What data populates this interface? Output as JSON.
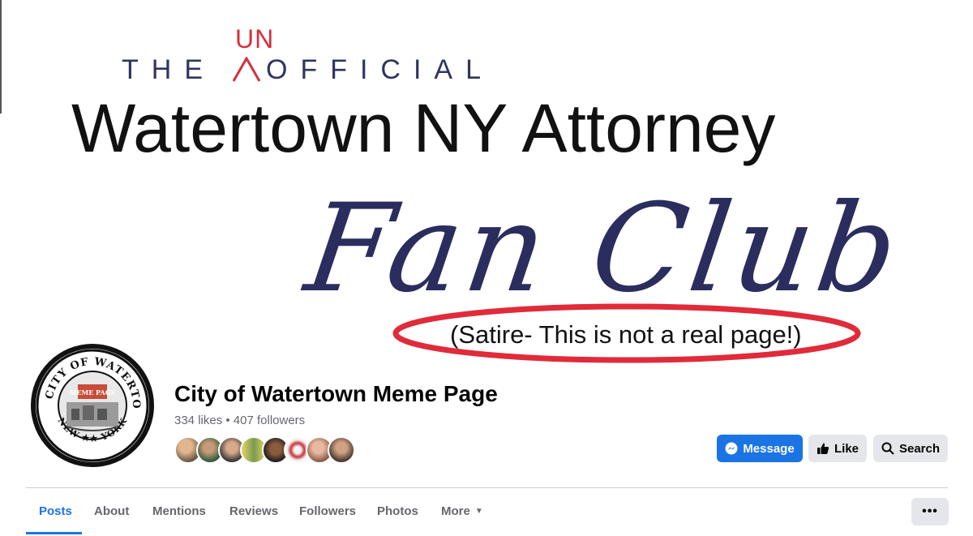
{
  "cover": {
    "line1_the": "THE",
    "line1_un": "UN",
    "line1_official": "OFFICIAL",
    "line2": "Watertown NY Attorney",
    "line3": "Fan Club",
    "satire": "(Satire- This is not a real page!)"
  },
  "profile": {
    "logo_ring_top": "THE CITY OF WATERTOWN",
    "logo_ring_bottom": "NEW ★★ YORK",
    "logo_banner": "MEME PAGE"
  },
  "page": {
    "name": "City of Watertown Meme Page",
    "stats": "334 likes • 407 followers",
    "friend_avatar_count": 8
  },
  "actions": {
    "message": "Message",
    "like": "Like",
    "search": "Search"
  },
  "tabs": {
    "items": [
      "Posts",
      "About",
      "Mentions",
      "Reviews",
      "Followers",
      "Photos",
      "More"
    ],
    "active": "Posts",
    "more_icon": "caret-down-icon",
    "overflow_icon": "ellipsis-icon"
  },
  "colors": {
    "accent": "#1b74e4",
    "script_navy": "#2a2d5e",
    "satire_red": "#e02b3a"
  }
}
